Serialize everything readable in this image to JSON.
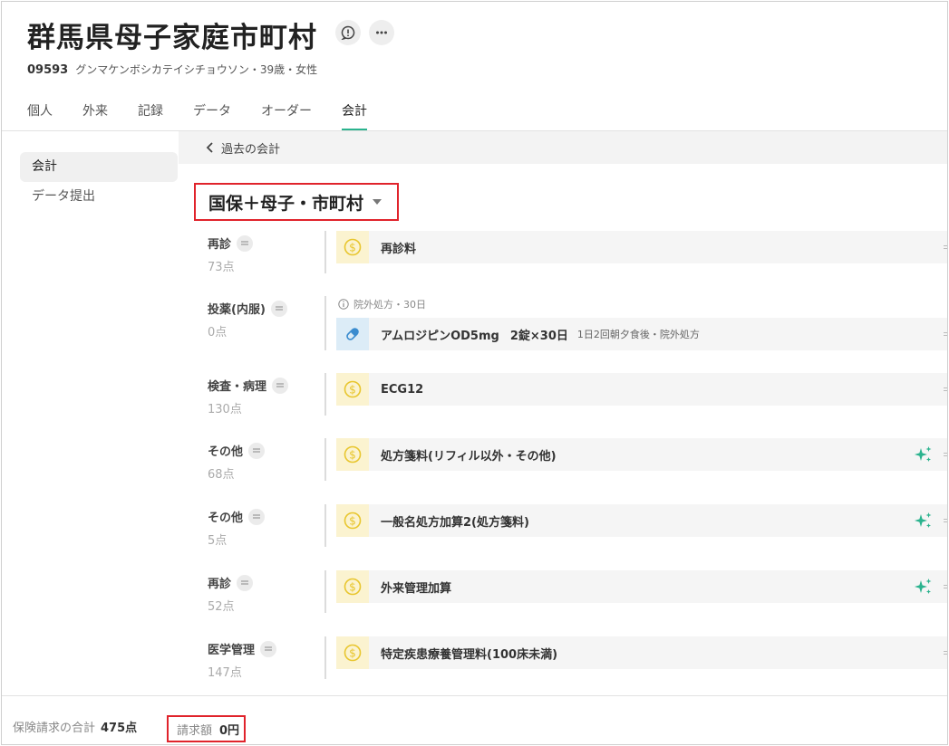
{
  "patient": {
    "name": "群馬県母子家庭市町村",
    "id": "09593",
    "details": "グンマケンボシカテイシチョウソン・39歳・女性"
  },
  "tabs": [
    {
      "label": "個人"
    },
    {
      "label": "外来"
    },
    {
      "label": "記録"
    },
    {
      "label": "データ"
    },
    {
      "label": "オーダー"
    },
    {
      "label": "会計",
      "active": true
    }
  ],
  "sidebar": {
    "items": [
      {
        "label": "会計",
        "active": true
      },
      {
        "label": "データ提出"
      }
    ]
  },
  "main": {
    "back_label": "過去の会計",
    "insurance": "国保＋母子・市町村",
    "sections": [
      {
        "category": "再診",
        "points": "73点",
        "item": "再診料",
        "icon": "coin-icon"
      },
      {
        "category": "投薬(内服)",
        "points": "0点",
        "info": "院外処方・30日",
        "item": "アムロジピンOD5mg",
        "quantity": "2錠×30日",
        "note": "1日2回朝夕食後・院外処方",
        "icon": "pill-icon"
      },
      {
        "category": "検査・病理",
        "points": "130点",
        "item": "ECG12",
        "icon": "coin-icon"
      },
      {
        "category": "その他",
        "points": "68点",
        "item": "処方箋料(リフィル以外・その他)",
        "icon": "coin-icon",
        "sparkle": true
      },
      {
        "category": "その他",
        "points": "5点",
        "item": "一般名処方加算2(処方箋料)",
        "icon": "coin-icon",
        "sparkle": true
      },
      {
        "category": "再診",
        "points": "52点",
        "item": "外来管理加算",
        "icon": "coin-icon",
        "sparkle": true
      },
      {
        "category": "医学管理",
        "points": "147点",
        "item": "特定疾患療養管理料(100床未満)",
        "icon": "coin-icon"
      }
    ]
  },
  "footer": {
    "total_label": "保険請求の合計",
    "total_value": "475点",
    "billed_label": "請求額",
    "billed_value": "0円"
  },
  "colors": {
    "accent": "#2bb38e",
    "highlight_border": "#e0232b",
    "coin": "#e8c62e"
  }
}
